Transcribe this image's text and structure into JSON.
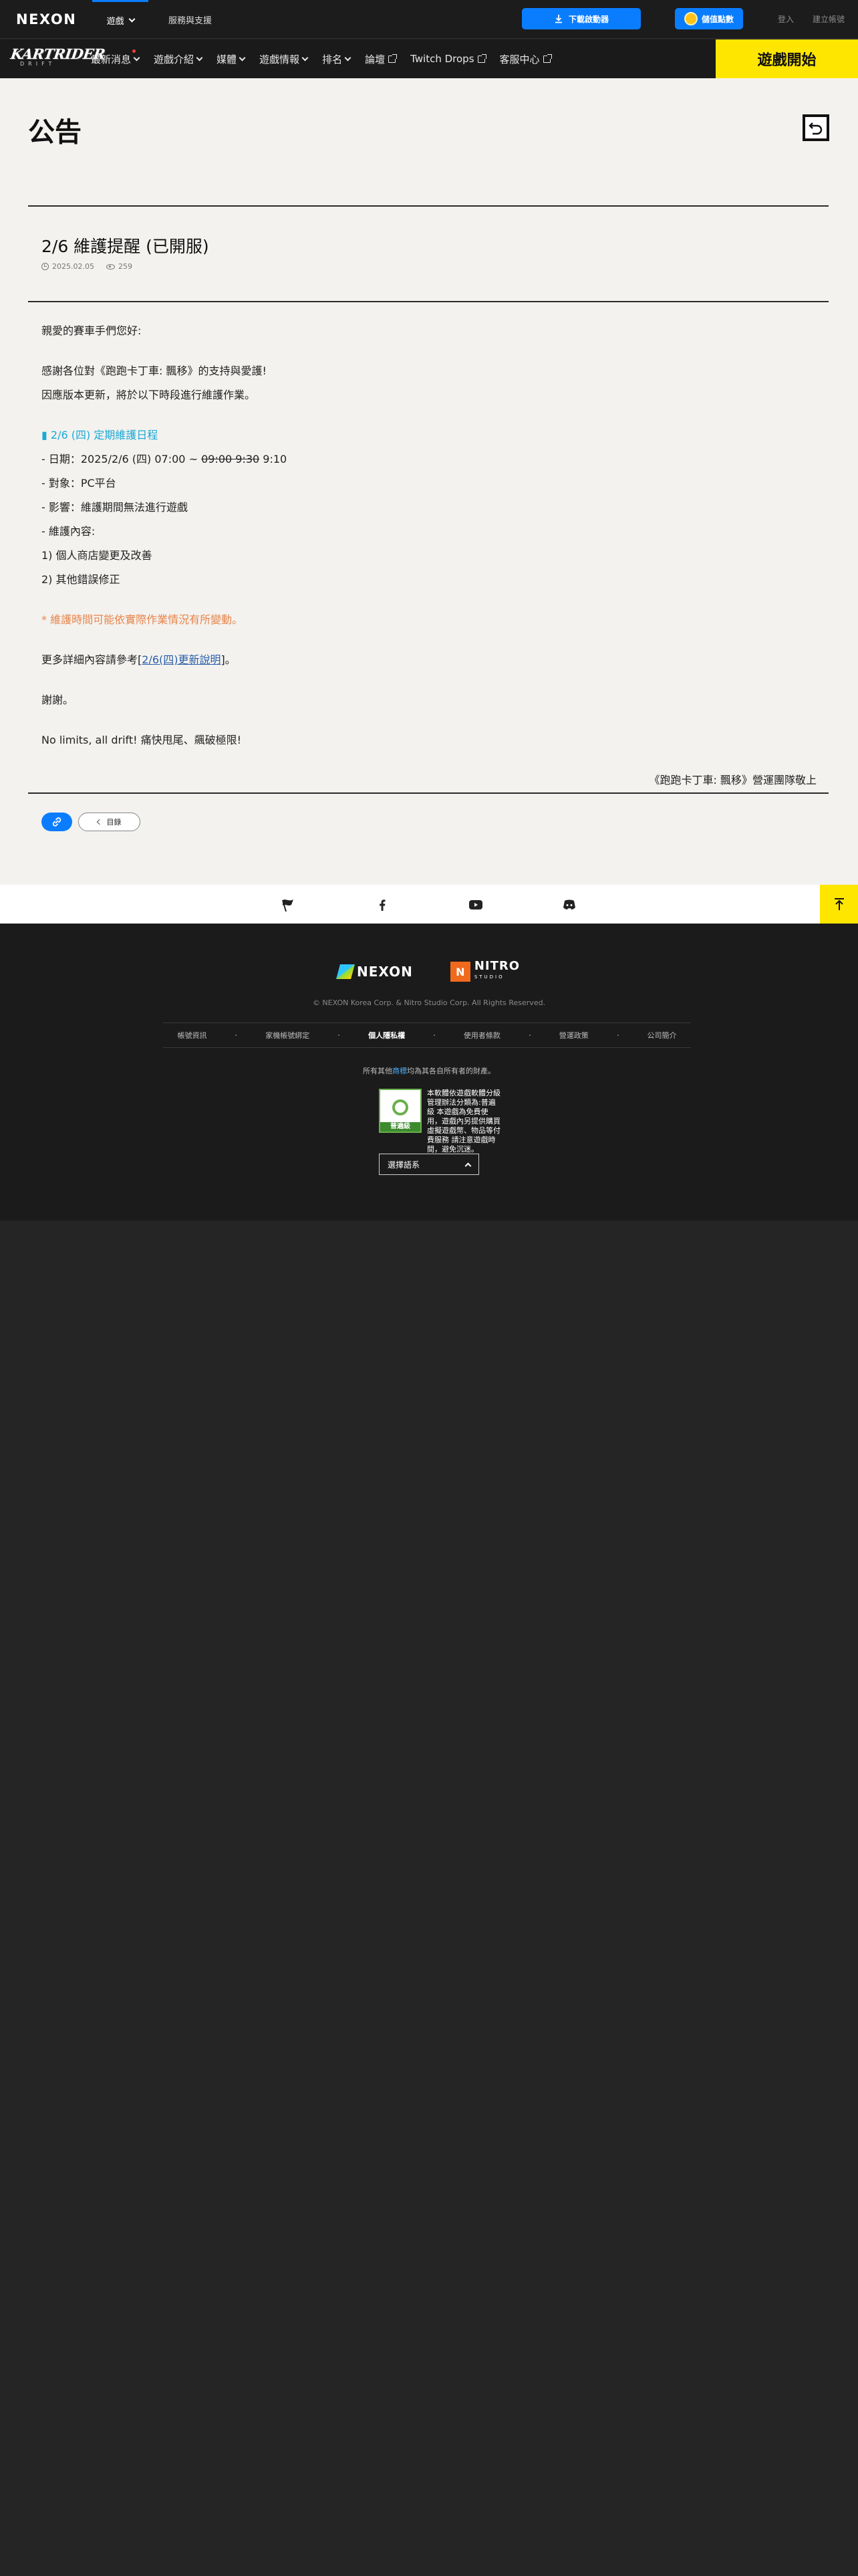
{
  "gnb": {
    "logo": "NEXON",
    "nav": [
      {
        "label": "遊戲"
      },
      {
        "label": "服務與支援"
      }
    ],
    "download_label": "下載啟動器",
    "points_label": "儲值點數",
    "login_label": "登入",
    "signup_label": "建立帳號"
  },
  "game_bar": {
    "logo_main": "KARTRIDER",
    "logo_sub": "DRIFT",
    "menu": [
      {
        "label": "最新消息"
      },
      {
        "label": "遊戲介紹"
      },
      {
        "label": "媒體"
      },
      {
        "label": "遊戲情報"
      },
      {
        "label": "排名"
      },
      {
        "label": "論壇"
      },
      {
        "label": "Twitch Drops"
      },
      {
        "label": "客服中心"
      }
    ],
    "play_label": "遊戲開始"
  },
  "page": {
    "title": "公告"
  },
  "article": {
    "title": "2/6 維護提醒 (已開服)",
    "date": "2025.02.05",
    "views": "259",
    "greeting": "親愛的賽車手們您好:",
    "thanks": "感謝各位對《跑跑卡丁車: 飄移》的支持與愛護!",
    "intro": "因應版本更新，將於以下時段進行維護作業。",
    "schedule_title": "▮ 2/6 (四) 定期維護日程",
    "date_line_prefix": "- 日期：2025/2/6 (四) 07:00 ~ ",
    "date_line_struck": "09:00 9:30",
    "date_line_suffix": " 9:10",
    "target_line": "- 對象：PC平台",
    "impact_line": "- 影響：維護期間無法進行遊戲",
    "content_line": "- 維護內容:",
    "item1": "1) 個人商店變更及改善",
    "item2": "2) 其他錯誤修正",
    "note": "* 維護時間可能依實際作業情況有所變動。",
    "more_prefix": "更多詳細內容請參考[",
    "more_link": "2/6(四)更新說明",
    "more_suffix": "]。",
    "thank_you": "謝謝。",
    "slogan": "No limits, all drift! 痛快甩尾、飆破極限!",
    "signature": "《跑跑卡丁車: 飄移》營運團隊敬上"
  },
  "actions": {
    "list_label": "目錄"
  },
  "footer": {
    "nexon_logo": "NEXON",
    "nitro_logo": "NITRO",
    "nitro_sub": "STUDIO",
    "copyright": "© NEXON Korea Corp. & Nitro Studio Corp. All Rights Reserved.",
    "links": [
      {
        "label": "帳號資訊",
        "bold": false
      },
      {
        "label": "家機帳號綁定",
        "bold": false
      },
      {
        "label": "個人隱私權",
        "bold": true
      },
      {
        "label": "使用者條款",
        "bold": false
      },
      {
        "label": "營運政策",
        "bold": false
      },
      {
        "label": "公司簡介",
        "bold": false
      }
    ],
    "trademark_prefix": "所有其他",
    "trademark_link": "商標",
    "trademark_suffix": "均為其各自所有者的財產。",
    "rating_badge": "普遍級",
    "rating_text": "本軟體依遊戲軟體分級管理辦法分類為:普遍級 本遊戲為免費使用，遊戲內另提供購買虛擬遊戲幣、物品等付費服務 請注意遊戲時間，避免沉迷。",
    "language_label": "選擇語系"
  },
  "colors": {
    "accent_blue": "#0a7dff",
    "play_yellow": "#ffe600",
    "schedule_cyan": "#19a9d6",
    "note_orange": "#e8844a"
  }
}
